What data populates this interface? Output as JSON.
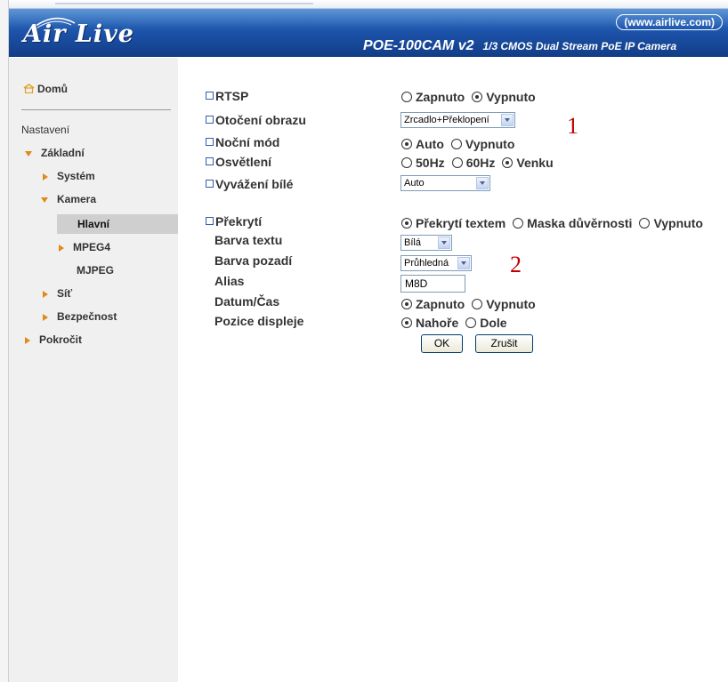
{
  "header": {
    "logo": "Air Live",
    "url": "(www.airlive.com)",
    "product": "POE-100CAM v2",
    "description": "1/3 CMOS Dual Stream PoE IP Camera"
  },
  "sidebar": {
    "home": "Domů",
    "settings": "Nastavení",
    "basic": "Základní",
    "system": "Systém",
    "camera": "Kamera",
    "main": "Hlavní",
    "mpeg4": "MPEG4",
    "mjpeg": "MJPEG",
    "network": "Síť",
    "security": "Bezpečnost",
    "advanced": "Pokročit"
  },
  "form": {
    "rtsp": {
      "label": "RTSP",
      "on": "Zapnuto",
      "off": "Vypnuto",
      "selected": "Vypnuto"
    },
    "rotate": {
      "label": "Otočení obrazu",
      "value": "Zrcadlo+Překlopení"
    },
    "night": {
      "label": "Noční mód",
      "auto": "Auto",
      "off": "Vypnuto",
      "selected": "Auto"
    },
    "light": {
      "label": "Osvětlení",
      "hz50": "50Hz",
      "hz60": "60Hz",
      "outdoor": "Venku",
      "selected": "Venku"
    },
    "wb": {
      "label": "Vyvážení bílé",
      "value": "Auto"
    },
    "overlay": {
      "label": "Překrytí",
      "text": "Překrytí textem",
      "mask": "Maska důvěrnosti",
      "off": "Vypnuto",
      "selected": "Překrytí textem"
    },
    "text_color": {
      "label": "Barva textu",
      "value": "Bílá"
    },
    "bg_color": {
      "label": "Barva pozadí",
      "value": "Průhledná"
    },
    "alias": {
      "label": "Alias",
      "value": "M8D"
    },
    "datetime": {
      "label": "Datum/Čas",
      "on": "Zapnuto",
      "off": "Vypnuto",
      "selected": "Zapnuto"
    },
    "position": {
      "label": "Pozice displeje",
      "top": "Nahoře",
      "bottom": "Dole",
      "selected": "Nahoře"
    },
    "ok": "OK",
    "cancel": "Zrušit"
  },
  "annotations": {
    "one": "1",
    "two": "2"
  },
  "colors": {
    "header_blue": "#1b4fa5",
    "annotation_red": "#c00000",
    "menu_arrow": "#e08a1a"
  }
}
